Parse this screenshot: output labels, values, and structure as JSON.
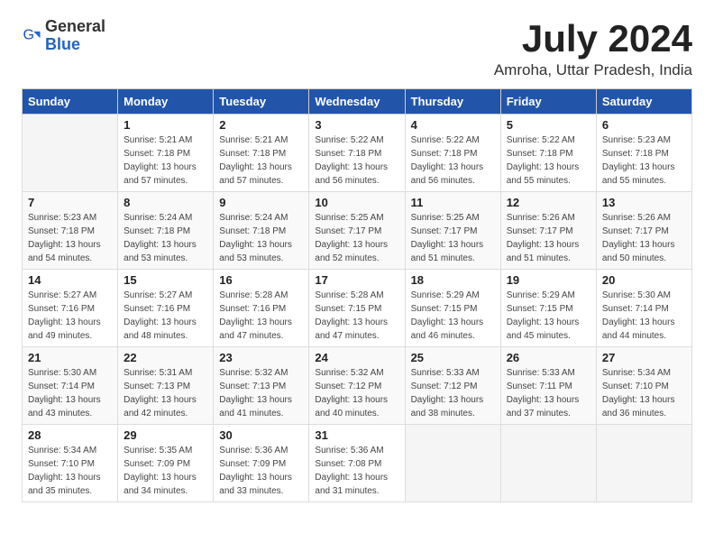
{
  "logo": {
    "general": "General",
    "blue": "Blue"
  },
  "title": "July 2024",
  "subtitle": "Amroha, Uttar Pradesh, India",
  "headers": [
    "Sunday",
    "Monday",
    "Tuesday",
    "Wednesday",
    "Thursday",
    "Friday",
    "Saturday"
  ],
  "weeks": [
    [
      {
        "day": "",
        "info": ""
      },
      {
        "day": "1",
        "info": "Sunrise: 5:21 AM\nSunset: 7:18 PM\nDaylight: 13 hours\nand 57 minutes."
      },
      {
        "day": "2",
        "info": "Sunrise: 5:21 AM\nSunset: 7:18 PM\nDaylight: 13 hours\nand 57 minutes."
      },
      {
        "day": "3",
        "info": "Sunrise: 5:22 AM\nSunset: 7:18 PM\nDaylight: 13 hours\nand 56 minutes."
      },
      {
        "day": "4",
        "info": "Sunrise: 5:22 AM\nSunset: 7:18 PM\nDaylight: 13 hours\nand 56 minutes."
      },
      {
        "day": "5",
        "info": "Sunrise: 5:22 AM\nSunset: 7:18 PM\nDaylight: 13 hours\nand 55 minutes."
      },
      {
        "day": "6",
        "info": "Sunrise: 5:23 AM\nSunset: 7:18 PM\nDaylight: 13 hours\nand 55 minutes."
      }
    ],
    [
      {
        "day": "7",
        "info": "Sunrise: 5:23 AM\nSunset: 7:18 PM\nDaylight: 13 hours\nand 54 minutes."
      },
      {
        "day": "8",
        "info": "Sunrise: 5:24 AM\nSunset: 7:18 PM\nDaylight: 13 hours\nand 53 minutes."
      },
      {
        "day": "9",
        "info": "Sunrise: 5:24 AM\nSunset: 7:18 PM\nDaylight: 13 hours\nand 53 minutes."
      },
      {
        "day": "10",
        "info": "Sunrise: 5:25 AM\nSunset: 7:17 PM\nDaylight: 13 hours\nand 52 minutes."
      },
      {
        "day": "11",
        "info": "Sunrise: 5:25 AM\nSunset: 7:17 PM\nDaylight: 13 hours\nand 51 minutes."
      },
      {
        "day": "12",
        "info": "Sunrise: 5:26 AM\nSunset: 7:17 PM\nDaylight: 13 hours\nand 51 minutes."
      },
      {
        "day": "13",
        "info": "Sunrise: 5:26 AM\nSunset: 7:17 PM\nDaylight: 13 hours\nand 50 minutes."
      }
    ],
    [
      {
        "day": "14",
        "info": "Sunrise: 5:27 AM\nSunset: 7:16 PM\nDaylight: 13 hours\nand 49 minutes."
      },
      {
        "day": "15",
        "info": "Sunrise: 5:27 AM\nSunset: 7:16 PM\nDaylight: 13 hours\nand 48 minutes."
      },
      {
        "day": "16",
        "info": "Sunrise: 5:28 AM\nSunset: 7:16 PM\nDaylight: 13 hours\nand 47 minutes."
      },
      {
        "day": "17",
        "info": "Sunrise: 5:28 AM\nSunset: 7:15 PM\nDaylight: 13 hours\nand 47 minutes."
      },
      {
        "day": "18",
        "info": "Sunrise: 5:29 AM\nSunset: 7:15 PM\nDaylight: 13 hours\nand 46 minutes."
      },
      {
        "day": "19",
        "info": "Sunrise: 5:29 AM\nSunset: 7:15 PM\nDaylight: 13 hours\nand 45 minutes."
      },
      {
        "day": "20",
        "info": "Sunrise: 5:30 AM\nSunset: 7:14 PM\nDaylight: 13 hours\nand 44 minutes."
      }
    ],
    [
      {
        "day": "21",
        "info": "Sunrise: 5:30 AM\nSunset: 7:14 PM\nDaylight: 13 hours\nand 43 minutes."
      },
      {
        "day": "22",
        "info": "Sunrise: 5:31 AM\nSunset: 7:13 PM\nDaylight: 13 hours\nand 42 minutes."
      },
      {
        "day": "23",
        "info": "Sunrise: 5:32 AM\nSunset: 7:13 PM\nDaylight: 13 hours\nand 41 minutes."
      },
      {
        "day": "24",
        "info": "Sunrise: 5:32 AM\nSunset: 7:12 PM\nDaylight: 13 hours\nand 40 minutes."
      },
      {
        "day": "25",
        "info": "Sunrise: 5:33 AM\nSunset: 7:12 PM\nDaylight: 13 hours\nand 38 minutes."
      },
      {
        "day": "26",
        "info": "Sunrise: 5:33 AM\nSunset: 7:11 PM\nDaylight: 13 hours\nand 37 minutes."
      },
      {
        "day": "27",
        "info": "Sunrise: 5:34 AM\nSunset: 7:10 PM\nDaylight: 13 hours\nand 36 minutes."
      }
    ],
    [
      {
        "day": "28",
        "info": "Sunrise: 5:34 AM\nSunset: 7:10 PM\nDaylight: 13 hours\nand 35 minutes."
      },
      {
        "day": "29",
        "info": "Sunrise: 5:35 AM\nSunset: 7:09 PM\nDaylight: 13 hours\nand 34 minutes."
      },
      {
        "day": "30",
        "info": "Sunrise: 5:36 AM\nSunset: 7:09 PM\nDaylight: 13 hours\nand 33 minutes."
      },
      {
        "day": "31",
        "info": "Sunrise: 5:36 AM\nSunset: 7:08 PM\nDaylight: 13 hours\nand 31 minutes."
      },
      {
        "day": "",
        "info": ""
      },
      {
        "day": "",
        "info": ""
      },
      {
        "day": "",
        "info": ""
      }
    ]
  ]
}
